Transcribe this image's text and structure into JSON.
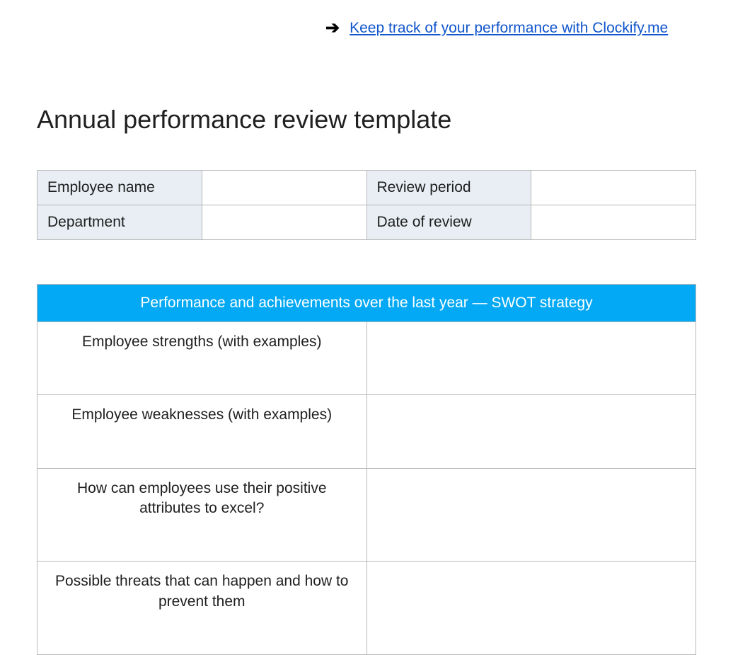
{
  "header": {
    "link_text": "Keep track of your performance with Clockify.me"
  },
  "title": "Annual performance review template",
  "info_table": {
    "rows": [
      {
        "label1": "Employee name",
        "value1": "",
        "label2": "Review period",
        "value2": ""
      },
      {
        "label1": "Department",
        "value1": "",
        "label2": "Date of review",
        "value2": ""
      }
    ]
  },
  "swot": {
    "header": "Performance and achievements over the last year — SWOT strategy",
    "rows": [
      {
        "label": "Employee strengths (with examples)",
        "value": ""
      },
      {
        "label": "Employee weaknesses (with examples)",
        "value": ""
      },
      {
        "label": "How can employees use their positive attributes to excel?",
        "value": ""
      },
      {
        "label": "Possible threats that can happen and how to prevent them",
        "value": ""
      }
    ]
  }
}
